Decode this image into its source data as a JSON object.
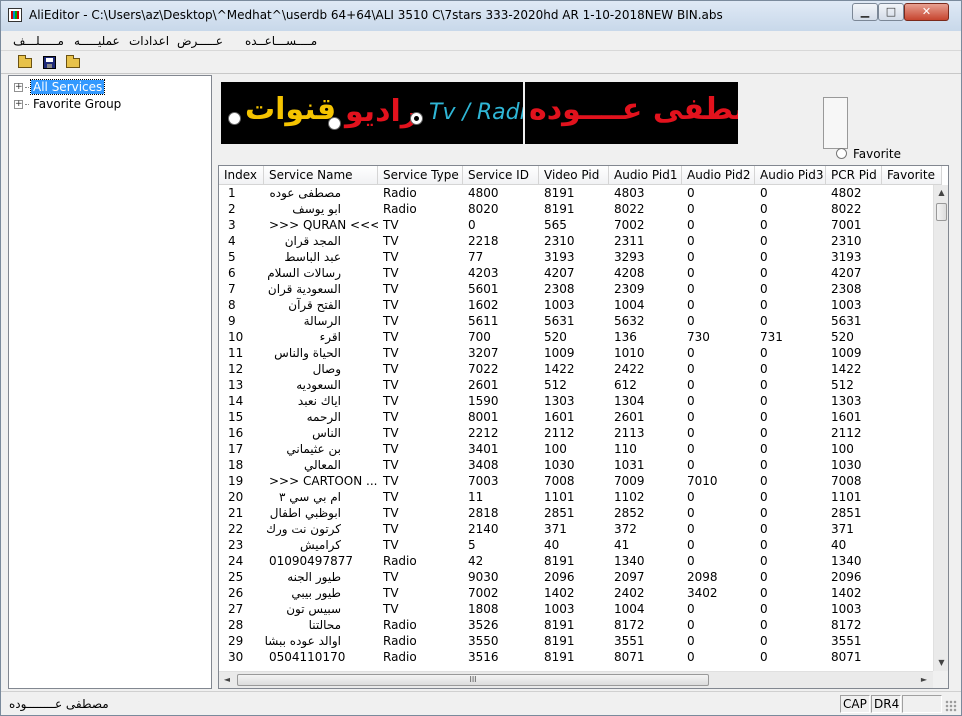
{
  "window": {
    "title": "AliEditor - C:\\Users\\az\\Desktop\\^Medhat^\\userdb 64+64\\ALI 3510 C\\7stars 333-2020hd  AR 1-10-2018NEW BIN.abs",
    "min_label": "▁",
    "max_label": "□",
    "close_label": "✕"
  },
  "menu": [
    "مـــــلـــف",
    "عمليـــــه",
    "اعدادات",
    "عـــــرض",
    "مــــســـاعــده"
  ],
  "tree": {
    "items": [
      {
        "label": "All Services",
        "expander": "+",
        "selected": true
      },
      {
        "label": "Favorite Group",
        "expander": "+",
        "selected": false
      }
    ]
  },
  "banner": {
    "tv_radio": "Tv / Radio",
    "radio_word": "راديو",
    "channels_word": "قنوات",
    "author": "م / مصطفى عــــوده"
  },
  "favorite_label": "Favorite",
  "grid": {
    "columns": [
      "Index",
      "Service Name",
      "Service Type",
      "Service ID",
      "Video Pid",
      "Audio Pid1",
      "Audio Pid2",
      "Audio Pid3",
      "PCR Pid",
      "Favorite"
    ],
    "rows": [
      [
        "1",
        "مصطفى عوده",
        "Radio",
        "4800",
        "8191",
        "4803",
        "0",
        "0",
        "4802"
      ],
      [
        "2",
        "ابو يوسف",
        "Radio",
        "8020",
        "8191",
        "8022",
        "0",
        "0",
        "8022"
      ],
      [
        "3",
        ">>> QURAN <<<",
        "TV",
        "0",
        "565",
        "7002",
        "0",
        "0",
        "7001"
      ],
      [
        "4",
        "المجد قران",
        "TV",
        "2218",
        "2310",
        "2311",
        "0",
        "0",
        "2310"
      ],
      [
        "5",
        "عبد الباسط",
        "TV",
        "77",
        "3193",
        "3293",
        "0",
        "0",
        "3193"
      ],
      [
        "6",
        "رسالات السلام",
        "TV",
        "4203",
        "4207",
        "4208",
        "0",
        "0",
        "4207"
      ],
      [
        "7",
        "السعودية قران",
        "TV",
        "5601",
        "2308",
        "2309",
        "0",
        "0",
        "2308"
      ],
      [
        "8",
        "الفتح قرآن",
        "TV",
        "1602",
        "1003",
        "1004",
        "0",
        "0",
        "1003"
      ],
      [
        "9",
        "الرسالة",
        "TV",
        "5611",
        "5631",
        "5632",
        "0",
        "0",
        "5631"
      ],
      [
        "10",
        "اقرء",
        "TV",
        "700",
        "520",
        "136",
        "730",
        "731",
        "520"
      ],
      [
        "11",
        "الحياة والناس",
        "TV",
        "3207",
        "1009",
        "1010",
        "0",
        "0",
        "1009"
      ],
      [
        "12",
        "وصال",
        "TV",
        "7022",
        "1422",
        "2422",
        "0",
        "0",
        "1422"
      ],
      [
        "13",
        "السعوديه",
        "TV",
        "2601",
        "512",
        "612",
        "0",
        "0",
        "512"
      ],
      [
        "14",
        "اياك نعبد",
        "TV",
        "1590",
        "1303",
        "1304",
        "0",
        "0",
        "1303"
      ],
      [
        "15",
        "الرحمه",
        "TV",
        "8001",
        "1601",
        "2601",
        "0",
        "0",
        "1601"
      ],
      [
        "16",
        "الناس",
        "TV",
        "2212",
        "2112",
        "2113",
        "0",
        "0",
        "2112"
      ],
      [
        "17",
        "بن عثيماني",
        "TV",
        "3401",
        "100",
        "110",
        "0",
        "0",
        "100"
      ],
      [
        "18",
        "المعالي",
        "TV",
        "3408",
        "1030",
        "1031",
        "0",
        "0",
        "1030"
      ],
      [
        "19",
        ">>> CARTOON ...",
        "TV",
        "7003",
        "7008",
        "7009",
        "7010",
        "0",
        "7008"
      ],
      [
        "20",
        "ام بي سي ٣",
        "TV",
        "11",
        "1101",
        "1102",
        "0",
        "0",
        "1101"
      ],
      [
        "21",
        "ابوظبي اطفال",
        "TV",
        "2818",
        "2851",
        "2852",
        "0",
        "0",
        "2851"
      ],
      [
        "22",
        "كرتون نت ورك",
        "TV",
        "2140",
        "371",
        "372",
        "0",
        "0",
        "371"
      ],
      [
        "23",
        "كراميش",
        "TV",
        "5",
        "40",
        "41",
        "0",
        "0",
        "40"
      ],
      [
        "24",
        "01090497877",
        "Radio",
        "42",
        "8191",
        "1340",
        "0",
        "0",
        "1340"
      ],
      [
        "25",
        "طيور الجنه",
        "TV",
        "9030",
        "2096",
        "2097",
        "2098",
        "0",
        "2096"
      ],
      [
        "26",
        "طيور بيبي",
        "TV",
        "7002",
        "1402",
        "2402",
        "3402",
        "0",
        "1402"
      ],
      [
        "27",
        "سبيس تون",
        "TV",
        "1808",
        "1003",
        "1004",
        "0",
        "0",
        "1003"
      ],
      [
        "28",
        "محالتنا",
        "Radio",
        "3526",
        "8191",
        "8172",
        "0",
        "0",
        "8172"
      ],
      [
        "29",
        "اوالد عوده ببشال",
        "Radio",
        "3550",
        "8191",
        "3551",
        "0",
        "0",
        "3551"
      ],
      [
        "30",
        "0504110170",
        "Radio",
        "3516",
        "8191",
        "8071",
        "0",
        "0",
        "8071"
      ]
    ]
  },
  "scroll": {
    "hthumb": "III",
    "left": "◄",
    "right": "►",
    "up": "▲",
    "down": "▼"
  },
  "status": {
    "text": "مصطفى عــــــــوده",
    "cap": "CAP",
    "dr": "DR4"
  },
  "colors": {
    "selection": "#3399ff",
    "banner_bg": "#000000",
    "banner_red": "#e2121d",
    "banner_yellow": "#f5c400",
    "banner_cyan": "#2fb6d6"
  }
}
